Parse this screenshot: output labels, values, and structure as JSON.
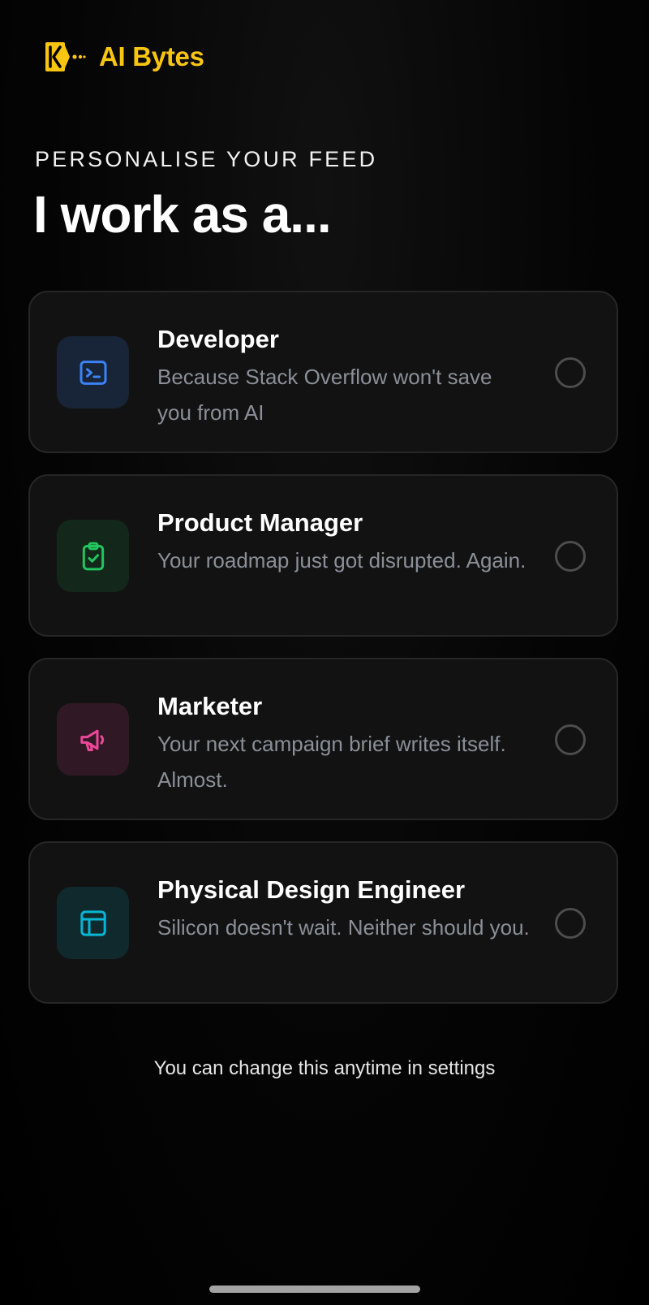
{
  "app": {
    "name": "AI Bytes",
    "brand_color": "#f7c512",
    "logo_icon": "ai-bytes-logo-icon"
  },
  "header": {
    "eyebrow": "PERSONALISE YOUR FEED",
    "title": "I work as a..."
  },
  "options": [
    {
      "title": "Developer",
      "description": "Because Stack Overflow won't save you from AI",
      "icon": "terminal-icon",
      "accent": "#3b82f6",
      "selected": false
    },
    {
      "title": "Product Manager",
      "description": "Your roadmap just got disrupted. Again.",
      "icon": "clipboard-check-icon",
      "accent": "#22c55e",
      "selected": false
    },
    {
      "title": "Marketer",
      "description": "Your next campaign brief writes itself. Almost.",
      "icon": "megaphone-icon",
      "accent": "#ec4899",
      "selected": false
    },
    {
      "title": "Physical Design Engineer",
      "description": "Silicon doesn't wait. Neither should you.",
      "icon": "layout-icon",
      "accent": "#06b6d4",
      "selected": false
    }
  ],
  "footer": {
    "note": "You can change this anytime in settings"
  }
}
